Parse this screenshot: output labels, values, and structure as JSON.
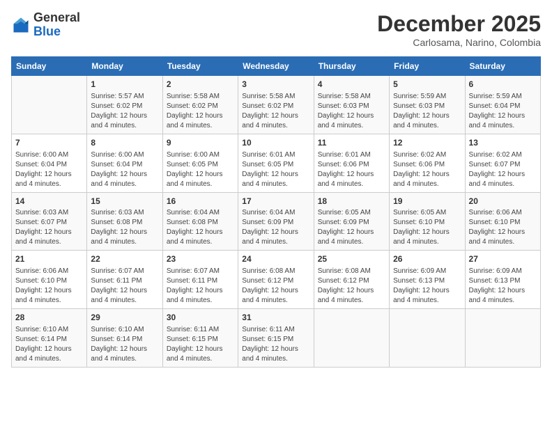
{
  "header": {
    "logo_general": "General",
    "logo_blue": "Blue",
    "month_title": "December 2025",
    "subtitle": "Carlosama, Narino, Colombia"
  },
  "days_of_week": [
    "Sunday",
    "Monday",
    "Tuesday",
    "Wednesday",
    "Thursday",
    "Friday",
    "Saturday"
  ],
  "weeks": [
    [
      {
        "day": "",
        "info": ""
      },
      {
        "day": "1",
        "info": "Sunrise: 5:57 AM\nSunset: 6:02 PM\nDaylight: 12 hours\nand 4 minutes."
      },
      {
        "day": "2",
        "info": "Sunrise: 5:58 AM\nSunset: 6:02 PM\nDaylight: 12 hours\nand 4 minutes."
      },
      {
        "day": "3",
        "info": "Sunrise: 5:58 AM\nSunset: 6:02 PM\nDaylight: 12 hours\nand 4 minutes."
      },
      {
        "day": "4",
        "info": "Sunrise: 5:58 AM\nSunset: 6:03 PM\nDaylight: 12 hours\nand 4 minutes."
      },
      {
        "day": "5",
        "info": "Sunrise: 5:59 AM\nSunset: 6:03 PM\nDaylight: 12 hours\nand 4 minutes."
      },
      {
        "day": "6",
        "info": "Sunrise: 5:59 AM\nSunset: 6:04 PM\nDaylight: 12 hours\nand 4 minutes."
      }
    ],
    [
      {
        "day": "7",
        "info": "Sunrise: 6:00 AM\nSunset: 6:04 PM\nDaylight: 12 hours\nand 4 minutes."
      },
      {
        "day": "8",
        "info": "Sunrise: 6:00 AM\nSunset: 6:04 PM\nDaylight: 12 hours\nand 4 minutes."
      },
      {
        "day": "9",
        "info": "Sunrise: 6:00 AM\nSunset: 6:05 PM\nDaylight: 12 hours\nand 4 minutes."
      },
      {
        "day": "10",
        "info": "Sunrise: 6:01 AM\nSunset: 6:05 PM\nDaylight: 12 hours\nand 4 minutes."
      },
      {
        "day": "11",
        "info": "Sunrise: 6:01 AM\nSunset: 6:06 PM\nDaylight: 12 hours\nand 4 minutes."
      },
      {
        "day": "12",
        "info": "Sunrise: 6:02 AM\nSunset: 6:06 PM\nDaylight: 12 hours\nand 4 minutes."
      },
      {
        "day": "13",
        "info": "Sunrise: 6:02 AM\nSunset: 6:07 PM\nDaylight: 12 hours\nand 4 minutes."
      }
    ],
    [
      {
        "day": "14",
        "info": "Sunrise: 6:03 AM\nSunset: 6:07 PM\nDaylight: 12 hours\nand 4 minutes."
      },
      {
        "day": "15",
        "info": "Sunrise: 6:03 AM\nSunset: 6:08 PM\nDaylight: 12 hours\nand 4 minutes."
      },
      {
        "day": "16",
        "info": "Sunrise: 6:04 AM\nSunset: 6:08 PM\nDaylight: 12 hours\nand 4 minutes."
      },
      {
        "day": "17",
        "info": "Sunrise: 6:04 AM\nSunset: 6:09 PM\nDaylight: 12 hours\nand 4 minutes."
      },
      {
        "day": "18",
        "info": "Sunrise: 6:05 AM\nSunset: 6:09 PM\nDaylight: 12 hours\nand 4 minutes."
      },
      {
        "day": "19",
        "info": "Sunrise: 6:05 AM\nSunset: 6:10 PM\nDaylight: 12 hours\nand 4 minutes."
      },
      {
        "day": "20",
        "info": "Sunrise: 6:06 AM\nSunset: 6:10 PM\nDaylight: 12 hours\nand 4 minutes."
      }
    ],
    [
      {
        "day": "21",
        "info": "Sunrise: 6:06 AM\nSunset: 6:10 PM\nDaylight: 12 hours\nand 4 minutes."
      },
      {
        "day": "22",
        "info": "Sunrise: 6:07 AM\nSunset: 6:11 PM\nDaylight: 12 hours\nand 4 minutes."
      },
      {
        "day": "23",
        "info": "Sunrise: 6:07 AM\nSunset: 6:11 PM\nDaylight: 12 hours\nand 4 minutes."
      },
      {
        "day": "24",
        "info": "Sunrise: 6:08 AM\nSunset: 6:12 PM\nDaylight: 12 hours\nand 4 minutes."
      },
      {
        "day": "25",
        "info": "Sunrise: 6:08 AM\nSunset: 6:12 PM\nDaylight: 12 hours\nand 4 minutes."
      },
      {
        "day": "26",
        "info": "Sunrise: 6:09 AM\nSunset: 6:13 PM\nDaylight: 12 hours\nand 4 minutes."
      },
      {
        "day": "27",
        "info": "Sunrise: 6:09 AM\nSunset: 6:13 PM\nDaylight: 12 hours\nand 4 minutes."
      }
    ],
    [
      {
        "day": "28",
        "info": "Sunrise: 6:10 AM\nSunset: 6:14 PM\nDaylight: 12 hours\nand 4 minutes."
      },
      {
        "day": "29",
        "info": "Sunrise: 6:10 AM\nSunset: 6:14 PM\nDaylight: 12 hours\nand 4 minutes."
      },
      {
        "day": "30",
        "info": "Sunrise: 6:11 AM\nSunset: 6:15 PM\nDaylight: 12 hours\nand 4 minutes."
      },
      {
        "day": "31",
        "info": "Sunrise: 6:11 AM\nSunset: 6:15 PM\nDaylight: 12 hours\nand 4 minutes."
      },
      {
        "day": "",
        "info": ""
      },
      {
        "day": "",
        "info": ""
      },
      {
        "day": "",
        "info": ""
      }
    ]
  ]
}
